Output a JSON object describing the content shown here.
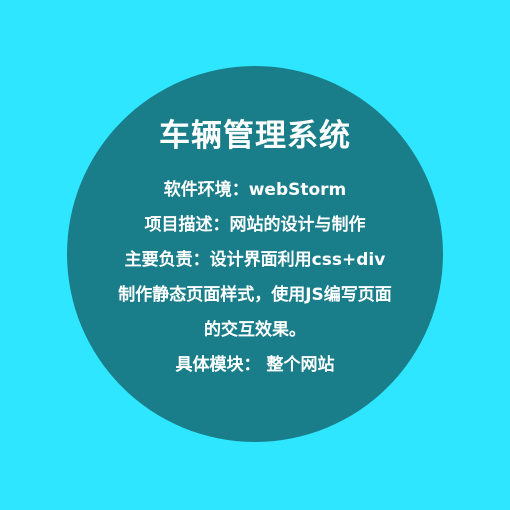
{
  "card": {
    "title": "车辆管理系统",
    "lines": [
      "软件环境：webStorm",
      "项目描述：网站的设计与制作",
      "主要负责：设计界面利用css+div",
      "制作静态页面样式，使用JS编写页面",
      "的交互效果。",
      "具体模块： 整个网站"
    ]
  },
  "colors": {
    "background": "#2EE6FF",
    "circle": "#1A7E8A",
    "text": "#FFFFFF"
  }
}
